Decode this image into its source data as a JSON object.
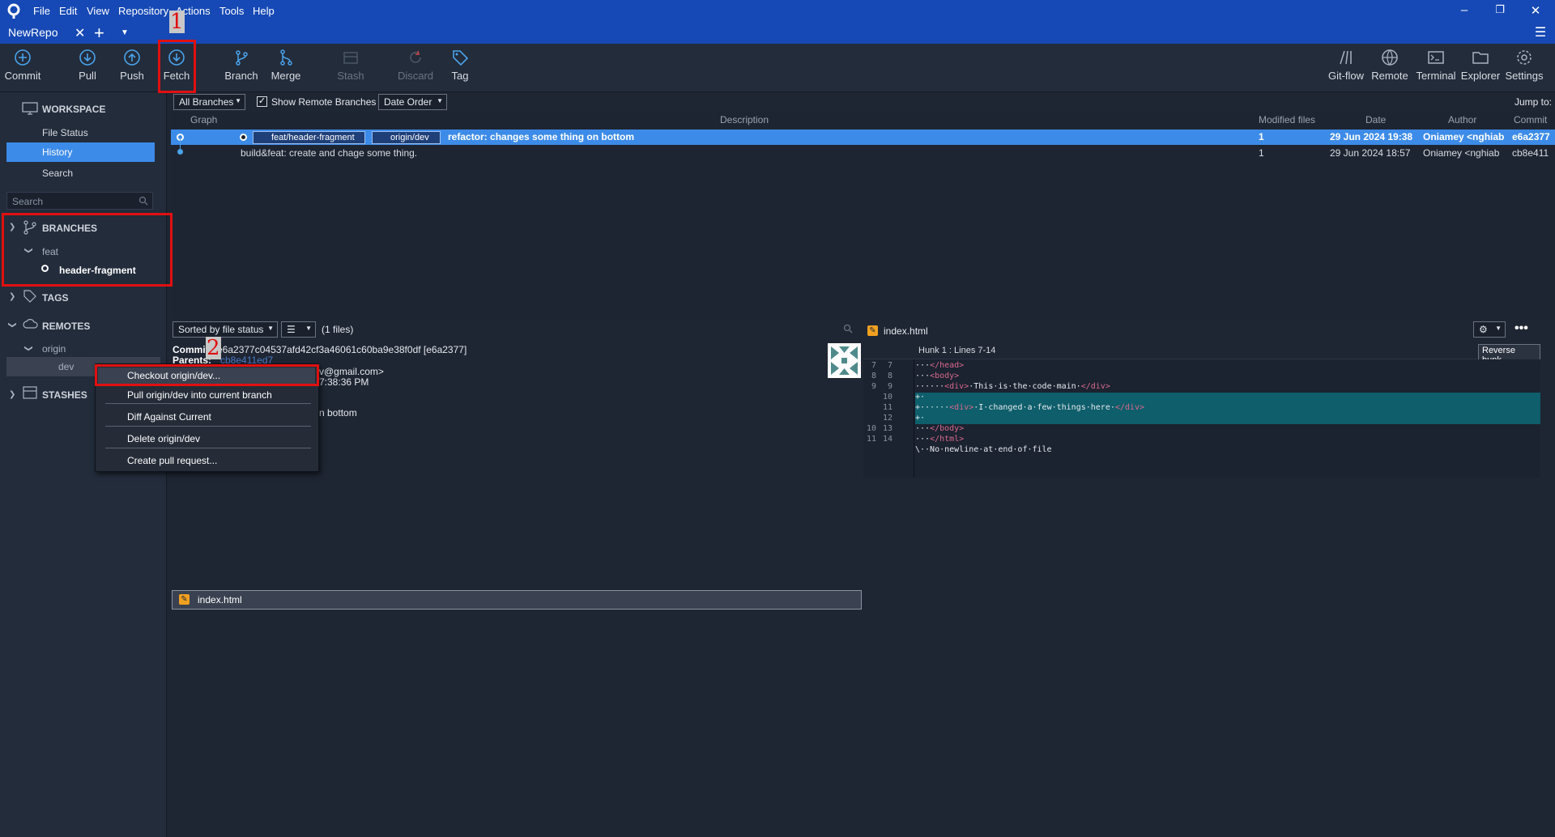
{
  "titlebar": {
    "menus": [
      "File",
      "Edit",
      "View",
      "Repository",
      "Actions",
      "Tools",
      "Help"
    ],
    "repo_tab": "NewRepo"
  },
  "toolbar": {
    "commit": "Commit",
    "pull": "Pull",
    "push": "Push",
    "fetch": "Fetch",
    "branch": "Branch",
    "merge": "Merge",
    "stash": "Stash",
    "discard": "Discard",
    "tag": "Tag",
    "gitflow": "Git-flow",
    "remote": "Remote",
    "terminal": "Terminal",
    "explorer": "Explorer",
    "settings": "Settings"
  },
  "sidebar": {
    "workspace": "WORKSPACE",
    "file_status": "File Status",
    "history": "History",
    "search": "Search",
    "search_placeholder": "Search",
    "branches": "BRANCHES",
    "feat": "feat",
    "header_fragment": "header-fragment",
    "tags": "TAGS",
    "remotes": "REMOTES",
    "origin": "origin",
    "dev": "dev",
    "stashes": "STASHES"
  },
  "filterbar": {
    "all_branches": "All Branches",
    "show_remote": "Show Remote Branches",
    "order": "Date Order",
    "jump_to": "Jump to:"
  },
  "commit_table": {
    "headers": [
      "Graph",
      "Description",
      "Modified files",
      "Date",
      "Author",
      "Commit"
    ],
    "rows": [
      {
        "tags": [
          "feat/header-fragment",
          "origin/dev"
        ],
        "description": "refactor: changes some thing on bottom",
        "modified": "1",
        "date": "29 Jun 2024 19:38",
        "author": "Oniamey <nghiab",
        "commit": "e6a2377"
      },
      {
        "tags": [],
        "description": "build&feat: create and chage some thing.",
        "modified": "1",
        "date": "29 Jun 2024 18:57",
        "author": "Oniamey <nghiab",
        "commit": "cb8e411"
      }
    ]
  },
  "detail": {
    "sort": "Sorted by file status",
    "file_count": "(1 files)",
    "commit_label": "Commit:",
    "commit_hash": "e6a2377c04537afd42cf3a46061c60ba9e38f0df [e6a2377]",
    "parents_label": "Parents:",
    "parents_hash": "cb8e411ed7",
    "email_partial": "v@gmail.com>",
    "time_partial": "7:38:36 PM",
    "msg_partial": "n bottom",
    "file_name": "index.html"
  },
  "diff": {
    "file_name": "index.html",
    "hunk": "Hunk 1 : Lines 7-14",
    "reverse": "Reverse hunk"
  },
  "context_menu": {
    "checkout": "Checkout origin/dev...",
    "pull": "Pull origin/dev into current branch",
    "diff": "Diff Against Current",
    "delete": "Delete origin/dev",
    "pr": "Create pull request..."
  },
  "annotations": {
    "one": "1",
    "two": "2"
  },
  "colors": {
    "titlebar": "#1649b5",
    "selection": "#3d8be8",
    "added": "#0e5e6b",
    "annotation": "#e01010"
  }
}
